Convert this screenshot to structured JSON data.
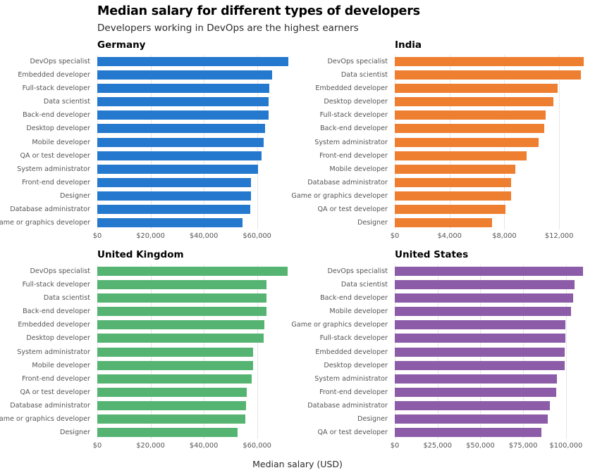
{
  "header": {
    "title": "Median salary for different types of developers",
    "subtitle": "Developers working in DevOps are the highest earners"
  },
  "axis_title": "Median salary (USD)",
  "chart_data": [
    {
      "type": "bar",
      "title": "Germany",
      "orientation": "horizontal",
      "color": "#2478ce",
      "xlabel": "Median salary (USD)",
      "ylabel": "",
      "xlim": [
        0,
        72000
      ],
      "grid": true,
      "legend": "none",
      "xticks": [
        0,
        20000,
        40000,
        60000
      ],
      "xticklabels": [
        "$0",
        "$20,000",
        "$40,000",
        "$60,000"
      ],
      "categories": [
        "DevOps specialist",
        "Embedded developer",
        "Full-stack developer",
        "Data scientist",
        "Back-end developer",
        "Desktop developer",
        "Mobile developer",
        "QA or test developer",
        "System administrator",
        "Front-end developer",
        "Designer",
        "Database administrator",
        "Game or graphics developer"
      ],
      "values": [
        71800,
        65600,
        64500,
        64400,
        64300,
        62900,
        62400,
        61600,
        60300,
        57600,
        57600,
        57500,
        54400
      ]
    },
    {
      "type": "bar",
      "title": "India",
      "orientation": "horizontal",
      "color": "#ee7f31",
      "xlabel": "Median salary (USD)",
      "ylabel": "",
      "xlim": [
        0,
        14000
      ],
      "grid": true,
      "legend": "none",
      "xticks": [
        0,
        4000,
        8000,
        12000
      ],
      "xticklabels": [
        "$0",
        "$4,000",
        "$8,000",
        "$12,000"
      ],
      "categories": [
        "DevOps specialist",
        "Data scientist",
        "Embedded developer",
        "Desktop developer",
        "Full-stack developer",
        "Back-end developer",
        "System administrator",
        "Front-end developer",
        "Mobile developer",
        "Database administrator",
        "Game or graphics developer",
        "QA or test developer",
        "Designer"
      ],
      "values": [
        13800,
        13600,
        11900,
        11600,
        11000,
        10900,
        10500,
        9600,
        8800,
        8500,
        8500,
        8100,
        7100
      ]
    },
    {
      "type": "bar",
      "title": "United Kingdom",
      "orientation": "horizontal",
      "color": "#55b472",
      "xlabel": "Median salary (USD)",
      "ylabel": "",
      "xlim": [
        0,
        72000
      ],
      "grid": true,
      "legend": "none",
      "xticks": [
        0,
        20000,
        40000,
        60000
      ],
      "xticklabels": [
        "$0",
        "$20,000",
        "$40,000",
        "$60,000"
      ],
      "categories": [
        "DevOps specialist",
        "Full-stack developer",
        "Data scientist",
        "Back-end developer",
        "Embedded developer",
        "Desktop developer",
        "System administrator",
        "Mobile developer",
        "Front-end developer",
        "QA or test developer",
        "Database administrator",
        "Game or graphics developer",
        "Designer"
      ],
      "values": [
        71500,
        63500,
        63500,
        63500,
        62700,
        62600,
        58600,
        58500,
        58100,
        56000,
        55900,
        55600,
        52800
      ]
    },
    {
      "type": "bar",
      "title": "United States",
      "orientation": "horizontal",
      "color": "#8c5ca8",
      "xlabel": "Median salary (USD)",
      "ylabel": "",
      "xlim": [
        0,
        112000
      ],
      "grid": true,
      "legend": "none",
      "xticks": [
        0,
        25000,
        50000,
        75000,
        100000
      ],
      "xticklabels": [
        "$0",
        "$25,000",
        "$50,000",
        "$75,000",
        "$100,000"
      ],
      "categories": [
        "DevOps specialist",
        "Data scientist",
        "Back-end developer",
        "Mobile developer",
        "Game or graphics developer",
        "Full-stack developer",
        "Embedded developer",
        "Desktop developer",
        "System administrator",
        "Front-end developer",
        "Database administrator",
        "Designer",
        "QA or test developer"
      ],
      "values": [
        110000,
        105000,
        104000,
        103000,
        99500,
        99500,
        99300,
        99200,
        94500,
        94300,
        90500,
        89500,
        85500
      ]
    }
  ]
}
